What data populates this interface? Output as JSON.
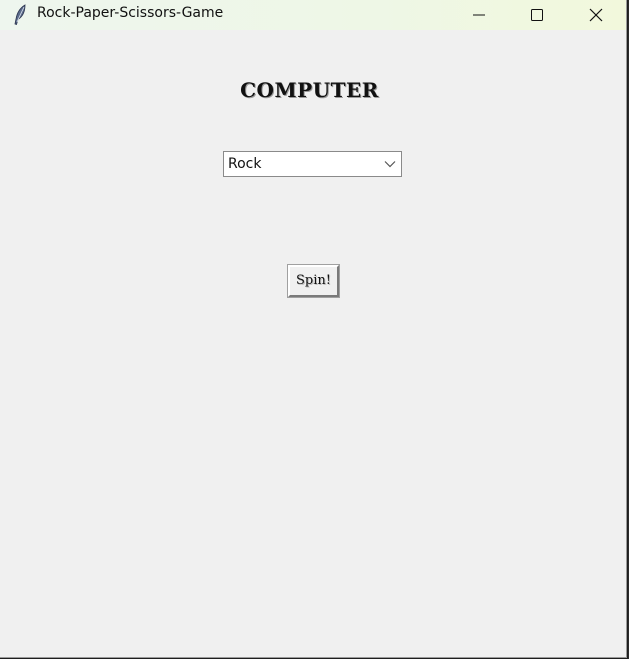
{
  "window": {
    "title": "Rock-Paper-Scissors-Game",
    "icon": "feather-icon",
    "controls": [
      "minimize-icon",
      "maximize-icon",
      "close-icon"
    ]
  },
  "main": {
    "heading": "COMPUTER",
    "choice_select": {
      "selected": "Rock"
    },
    "spin_button_label": "Spin!"
  }
}
